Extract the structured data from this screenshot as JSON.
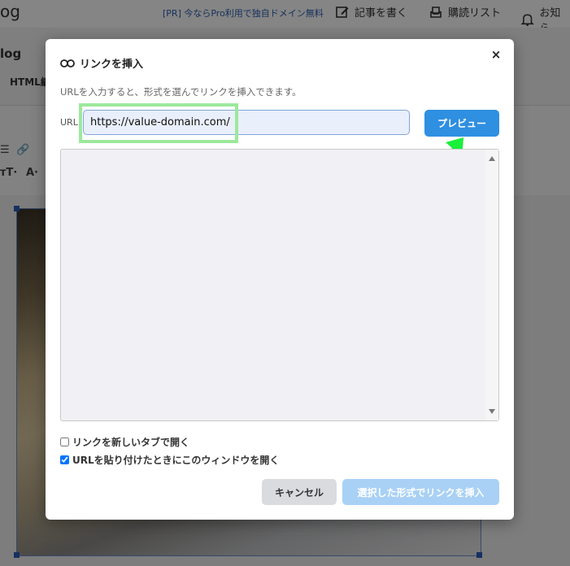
{
  "background": {
    "logo": "og",
    "pr_link": "[PR] 今ならPro利用で独自ドメイン無料",
    "nav": {
      "write": "記事を書く",
      "subscriptions": "購読リスト",
      "notifications": "お知ら"
    },
    "blog_title": "log",
    "html_tab": "HTML編",
    "toolbar": {
      "text_size": "тT·",
      "text_color": "A·"
    }
  },
  "modal": {
    "title": "リンクを挿入",
    "close": "×",
    "description": "URLを入力すると、形式を選んでリンクを挿入できます。",
    "url_label": "URL",
    "url_value": "https://value-domain.com/",
    "preview_button": "プレビュー",
    "options": [
      {
        "label": "リンクを新しいタブで開く",
        "checked": false
      },
      {
        "label": "URLを貼り付けたときにこのウィンドウを開く",
        "checked": true
      }
    ],
    "cancel_button": "キャンセル",
    "insert_button": "選択した形式でリンクを挿入"
  },
  "colors": {
    "primary": "#2f8fe0",
    "primary_disabled": "#a9d1f5",
    "highlight": "#9de89d",
    "arrow": "#19f03a"
  },
  "icons": [
    "link-icon",
    "edit-icon",
    "inbox-icon",
    "bell-icon",
    "close-icon",
    "arrow-annotation-icon"
  ]
}
